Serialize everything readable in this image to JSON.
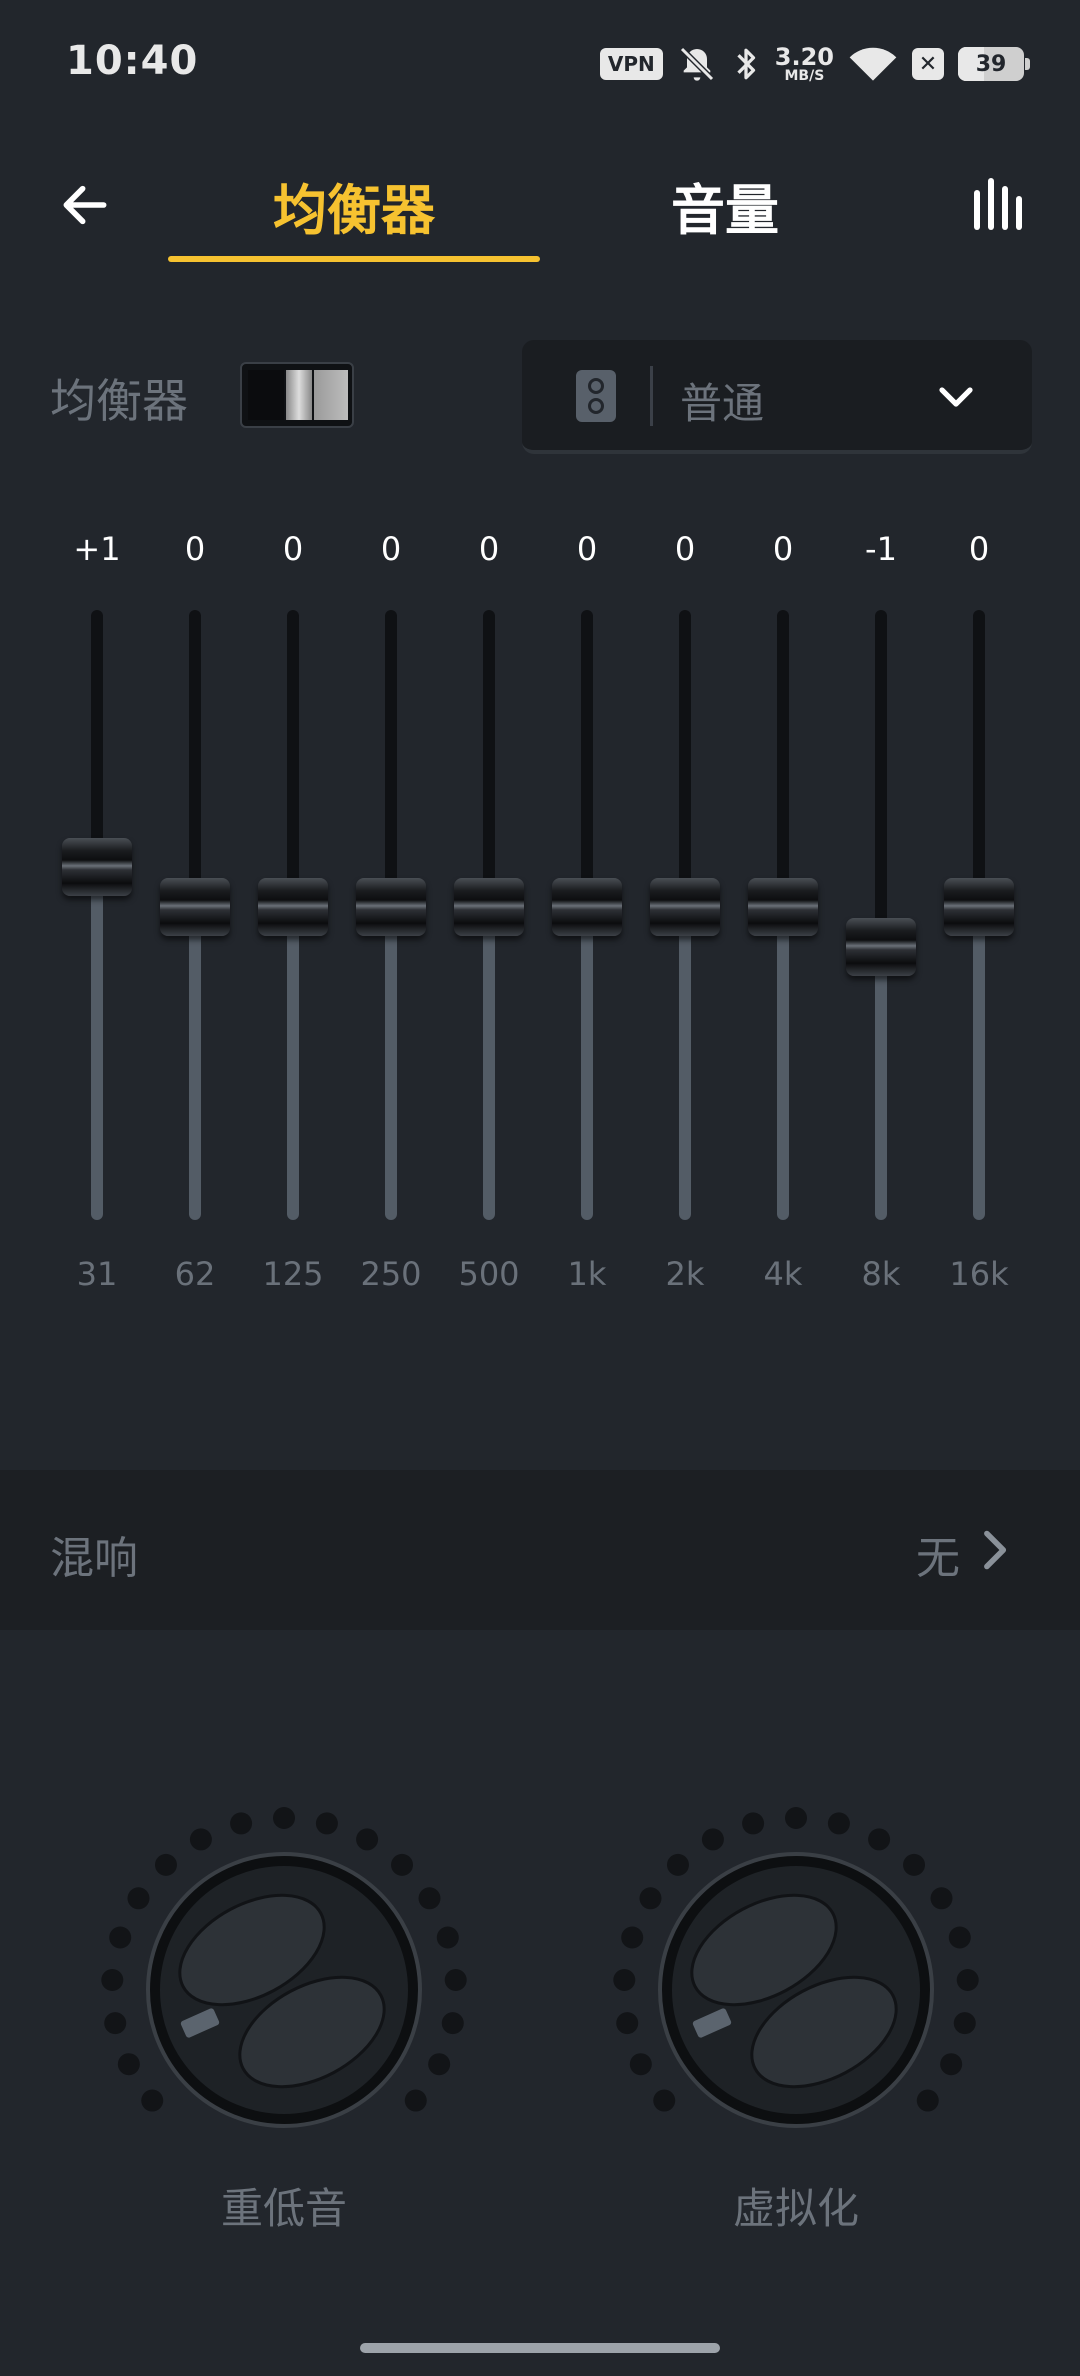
{
  "status": {
    "time": "10:40",
    "vpn": "VPN",
    "net_speed": "3.20",
    "net_unit": "MB/S",
    "battery": "39",
    "icons": [
      "vpn-badge",
      "bell-off-icon",
      "bluetooth-icon",
      "wifi-icon",
      "close-box-icon",
      "battery-icon"
    ]
  },
  "header": {
    "tabs": [
      {
        "label": "均衡器",
        "active": true
      },
      {
        "label": "音量",
        "active": false
      }
    ],
    "accent": "#f6c230"
  },
  "eq": {
    "toggle_label": "均衡器",
    "preset": "普通",
    "bands": [
      {
        "gain": "+1",
        "freq": "31",
        "level": 1
      },
      {
        "gain": "0",
        "freq": "62",
        "level": 0
      },
      {
        "gain": "0",
        "freq": "125",
        "level": 0
      },
      {
        "gain": "0",
        "freq": "250",
        "level": 0
      },
      {
        "gain": "0",
        "freq": "500",
        "level": 0
      },
      {
        "gain": "0",
        "freq": "1k",
        "level": 0
      },
      {
        "gain": "0",
        "freq": "2k",
        "level": 0
      },
      {
        "gain": "0",
        "freq": "4k",
        "level": 0
      },
      {
        "gain": "-1",
        "freq": "8k",
        "level": -1
      },
      {
        "gain": "0",
        "freq": "16k",
        "level": 0
      }
    ]
  },
  "reverb": {
    "label": "混响",
    "value": "无"
  },
  "knobs": [
    {
      "label": "重低音"
    },
    {
      "label": "虚拟化"
    }
  ]
}
